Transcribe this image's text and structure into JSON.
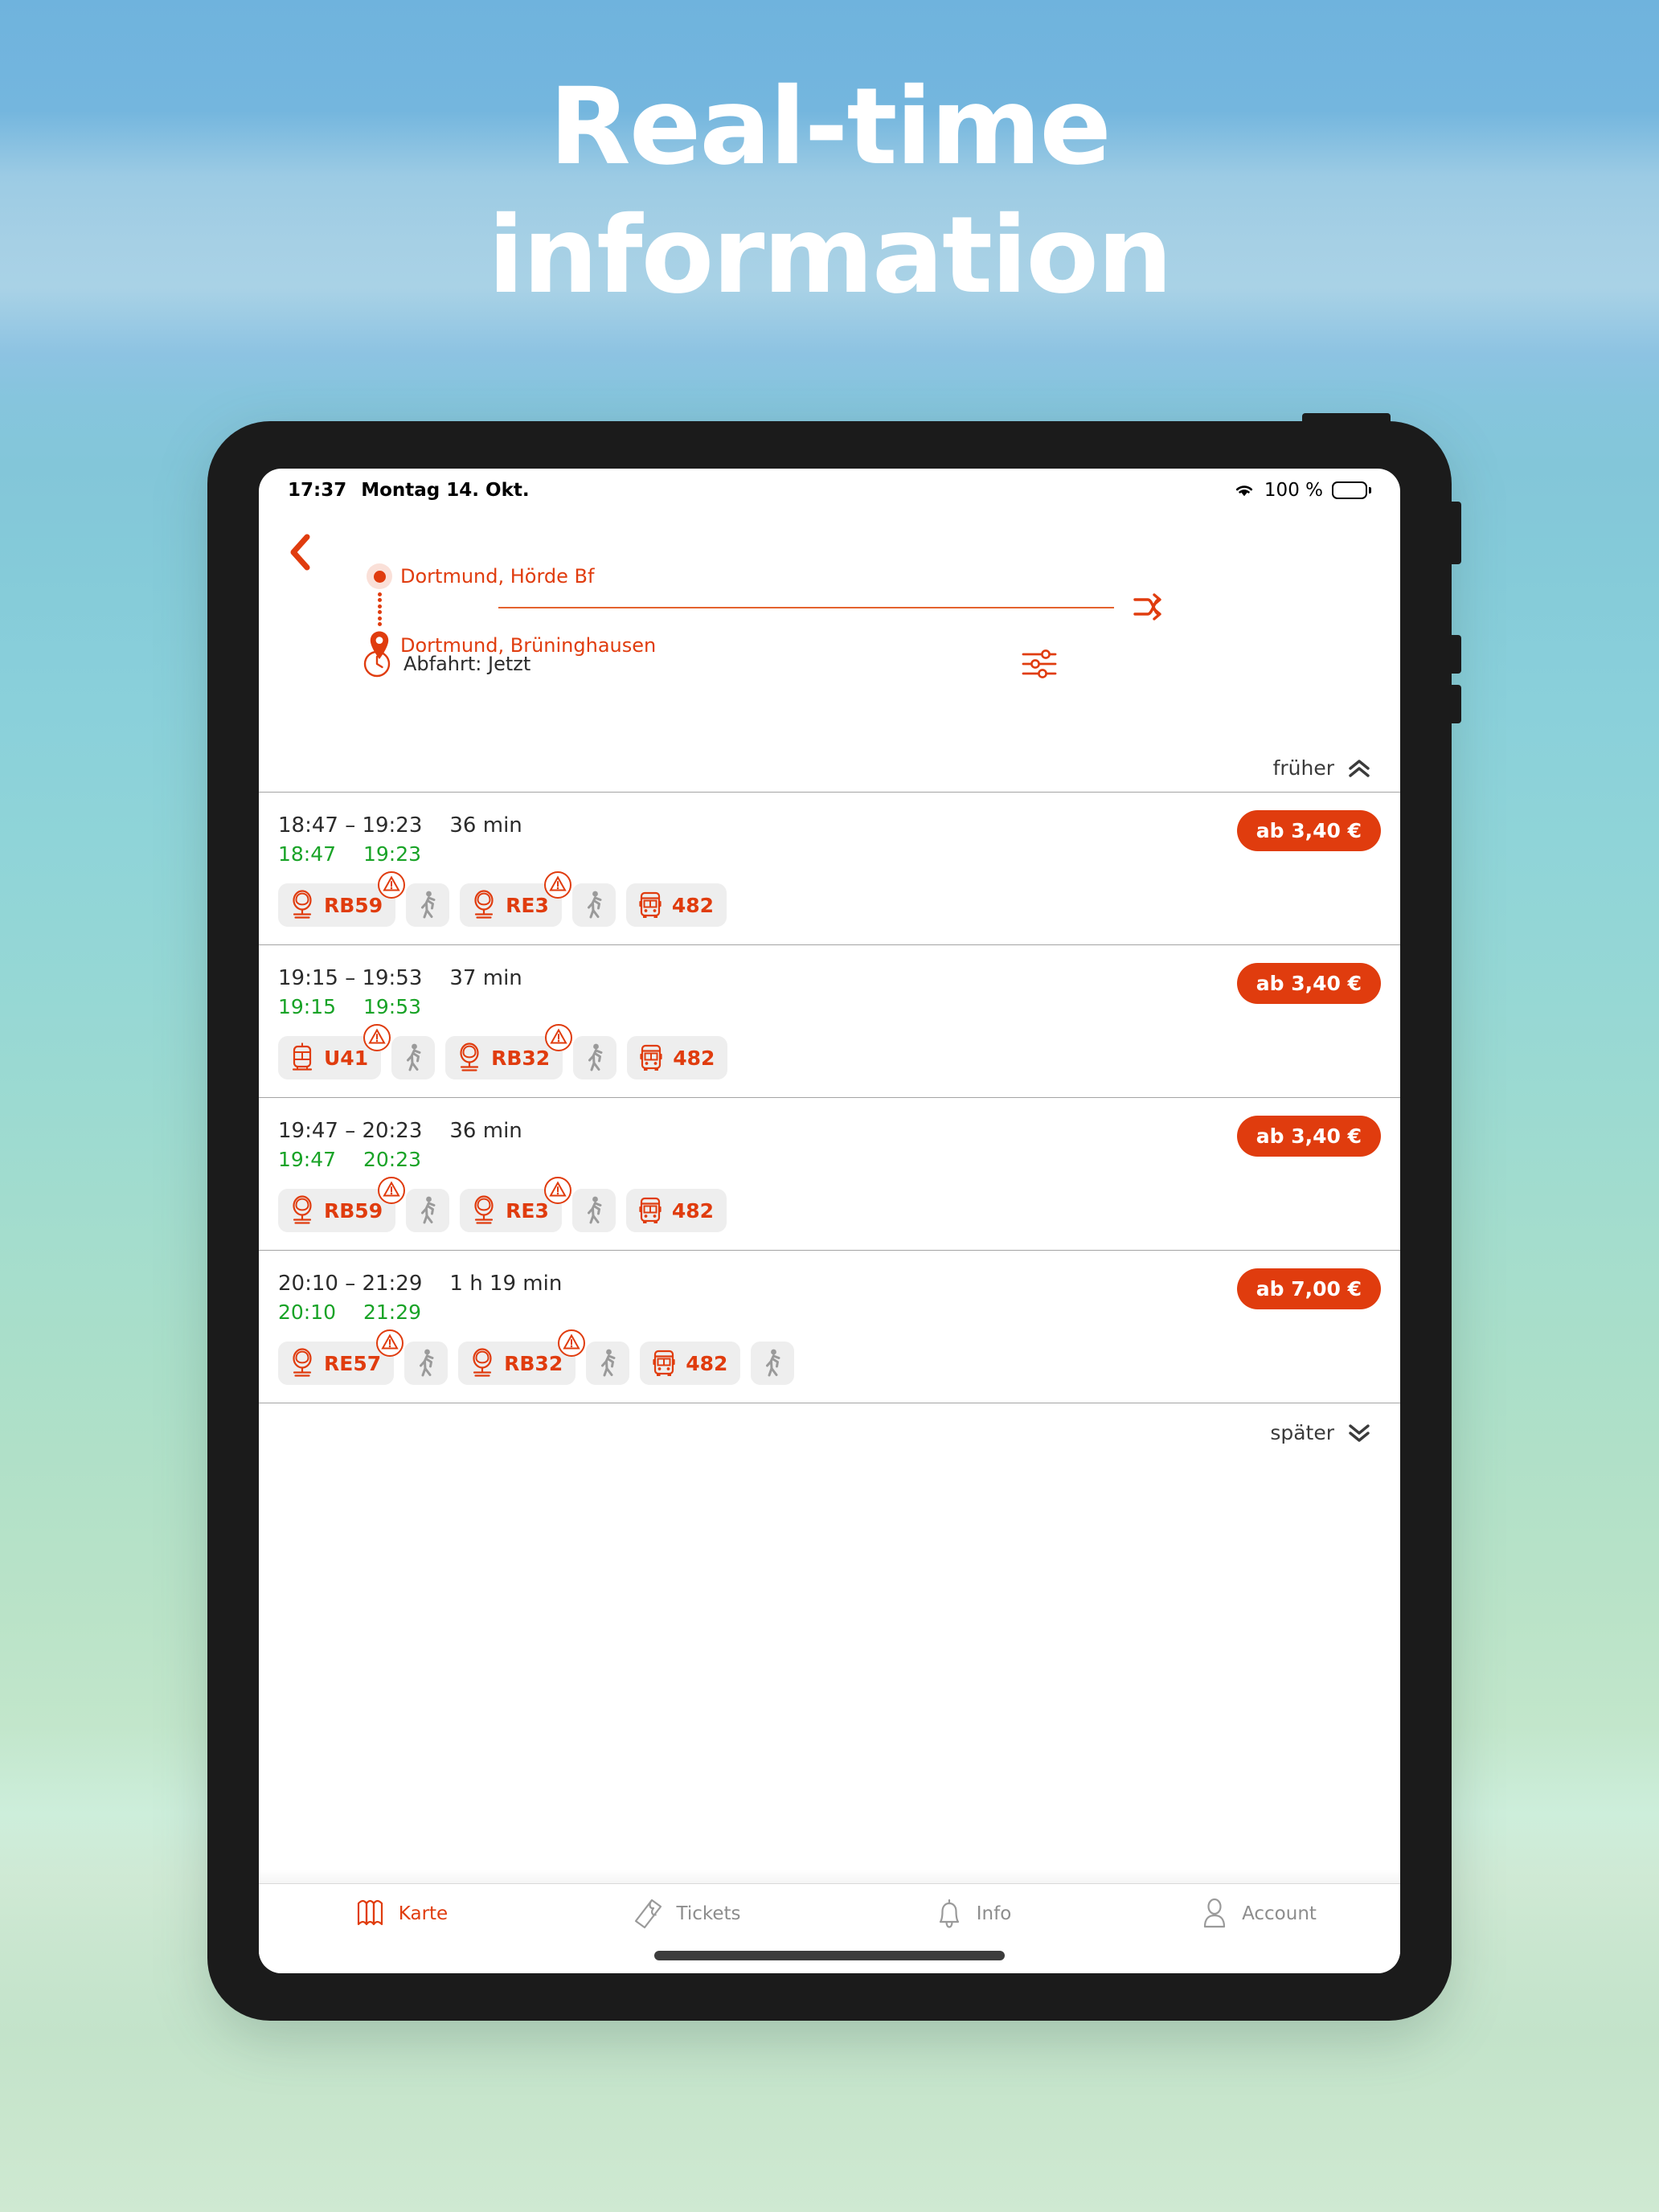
{
  "promo": {
    "headline_line1": "Real-time",
    "headline_line2": "information"
  },
  "statusbar": {
    "time": "17:37",
    "date": "Montag 14. Okt.",
    "battery_percent": "100 %",
    "wifi_icon": "wifi-icon",
    "battery_icon": "battery-full-icon"
  },
  "header": {
    "back_icon": "chevron-left-icon",
    "origin": "Dortmund, Hörde Bf",
    "destination": "Dortmund, Brüninghausen",
    "origin_icon": "origin-dot-icon",
    "destination_icon": "map-pin-icon",
    "swap_icon": "swap-arrows-icon",
    "clock_icon": "clock-icon",
    "departure_label": "Abfahrt: Jetzt",
    "filter_icon": "filter-sliders-icon"
  },
  "list_controls": {
    "earlier_label": "früher",
    "earlier_icon": "chevron-double-up-icon",
    "later_label": "später",
    "later_icon": "chevron-double-down-icon"
  },
  "colors": {
    "accent": "#e03c0e",
    "realtime_green": "#19a327",
    "leg_chip_bg": "#eeeeee",
    "text_primary": "#2b2b2b",
    "text_muted": "#8d8d8d"
  },
  "journeys": [
    {
      "planned_range": "18:47 – 19:23",
      "duration": "36 min",
      "realtime_departure": "18:47",
      "realtime_arrival": "19:23",
      "price": "ab 3,40 €",
      "legs": [
        {
          "type": "train",
          "icon": "train-icon",
          "label": "RB59",
          "alert": true
        },
        {
          "type": "walk",
          "icon": "walk-icon",
          "label": "",
          "alert": false
        },
        {
          "type": "train",
          "icon": "train-icon",
          "label": "RE3",
          "alert": true
        },
        {
          "type": "walk",
          "icon": "walk-icon",
          "label": "",
          "alert": false
        },
        {
          "type": "bus",
          "icon": "bus-icon",
          "label": "482",
          "alert": false
        }
      ]
    },
    {
      "planned_range": "19:15 – 19:53",
      "duration": "37 min",
      "realtime_departure": "19:15",
      "realtime_arrival": "19:53",
      "price": "ab 3,40 €",
      "legs": [
        {
          "type": "tram",
          "icon": "tram-icon",
          "label": "U41",
          "alert": true
        },
        {
          "type": "walk",
          "icon": "walk-icon",
          "label": "",
          "alert": false
        },
        {
          "type": "train",
          "icon": "train-icon",
          "label": "RB32",
          "alert": true
        },
        {
          "type": "walk",
          "icon": "walk-icon",
          "label": "",
          "alert": false
        },
        {
          "type": "bus",
          "icon": "bus-icon",
          "label": "482",
          "alert": false
        }
      ]
    },
    {
      "planned_range": "19:47 – 20:23",
      "duration": "36 min",
      "realtime_departure": "19:47",
      "realtime_arrival": "20:23",
      "price": "ab 3,40 €",
      "legs": [
        {
          "type": "train",
          "icon": "train-icon",
          "label": "RB59",
          "alert": true
        },
        {
          "type": "walk",
          "icon": "walk-icon",
          "label": "",
          "alert": false
        },
        {
          "type": "train",
          "icon": "train-icon",
          "label": "RE3",
          "alert": true
        },
        {
          "type": "walk",
          "icon": "walk-icon",
          "label": "",
          "alert": false
        },
        {
          "type": "bus",
          "icon": "bus-icon",
          "label": "482",
          "alert": false
        }
      ]
    },
    {
      "planned_range": "20:10 – 21:29",
      "duration": "1 h 19 min",
      "realtime_departure": "20:10",
      "realtime_arrival": "21:29",
      "price": "ab 7,00 €",
      "legs": [
        {
          "type": "train",
          "icon": "train-icon",
          "label": "RE57",
          "alert": true
        },
        {
          "type": "walk",
          "icon": "walk-icon",
          "label": "",
          "alert": false
        },
        {
          "type": "train",
          "icon": "train-icon",
          "label": "RB32",
          "alert": true
        },
        {
          "type": "walk",
          "icon": "walk-icon",
          "label": "",
          "alert": false
        },
        {
          "type": "bus",
          "icon": "bus-icon",
          "label": "482",
          "alert": false
        },
        {
          "type": "walk",
          "icon": "walk-icon",
          "label": "",
          "alert": false
        }
      ]
    }
  ],
  "tabbar": {
    "items": [
      {
        "label": "Karte",
        "icon": "map-icon",
        "active": true
      },
      {
        "label": "Tickets",
        "icon": "ticket-icon",
        "active": false
      },
      {
        "label": "Info",
        "icon": "bell-icon",
        "active": false
      },
      {
        "label": "Account",
        "icon": "person-icon",
        "active": false
      }
    ]
  }
}
